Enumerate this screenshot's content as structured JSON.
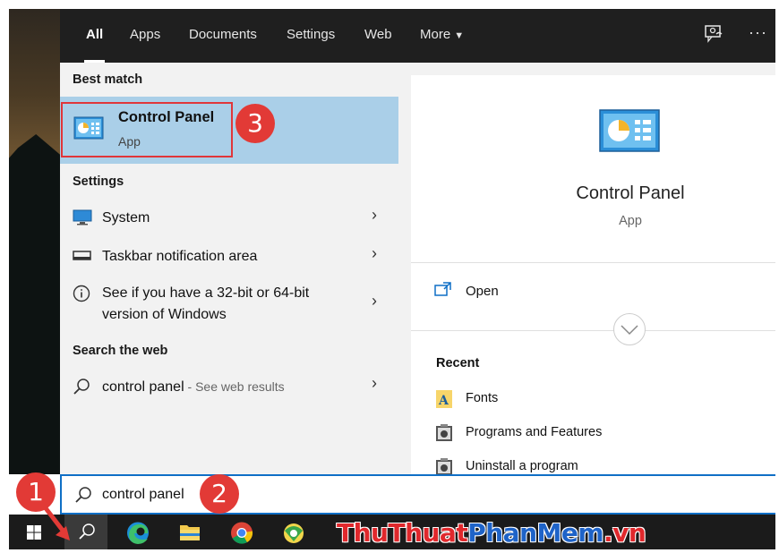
{
  "tabs": {
    "all": "All",
    "apps": "Apps",
    "documents": "Documents",
    "settings": "Settings",
    "web": "Web",
    "more": "More"
  },
  "best_match": {
    "heading": "Best match",
    "title": "Control Panel",
    "subtitle": "App"
  },
  "settings_section": {
    "heading": "Settings",
    "items": [
      {
        "label": "System"
      },
      {
        "label": "Taskbar notification area"
      },
      {
        "label_line1": "See if you have a 32-bit or 64-bit",
        "label_line2": "version of Windows"
      }
    ]
  },
  "web_section": {
    "heading": "Search the web",
    "query": "control panel",
    "suffix": " - See web results"
  },
  "preview": {
    "title": "Control Panel",
    "subtitle": "App",
    "open_label": "Open",
    "recent_heading": "Recent",
    "recent_items": [
      "Fonts",
      "Programs and Features",
      "Uninstall a program"
    ]
  },
  "search": {
    "value": "control panel"
  },
  "badges": {
    "one": "1",
    "two": "2",
    "three": "3"
  },
  "watermark": {
    "part1": "ThuThuat",
    "part2": "PhanMem",
    "part3": ".vn"
  },
  "colors": {
    "accent": "#0f6fc6",
    "selected": "#aacfe8",
    "badge": "#e23a36"
  }
}
